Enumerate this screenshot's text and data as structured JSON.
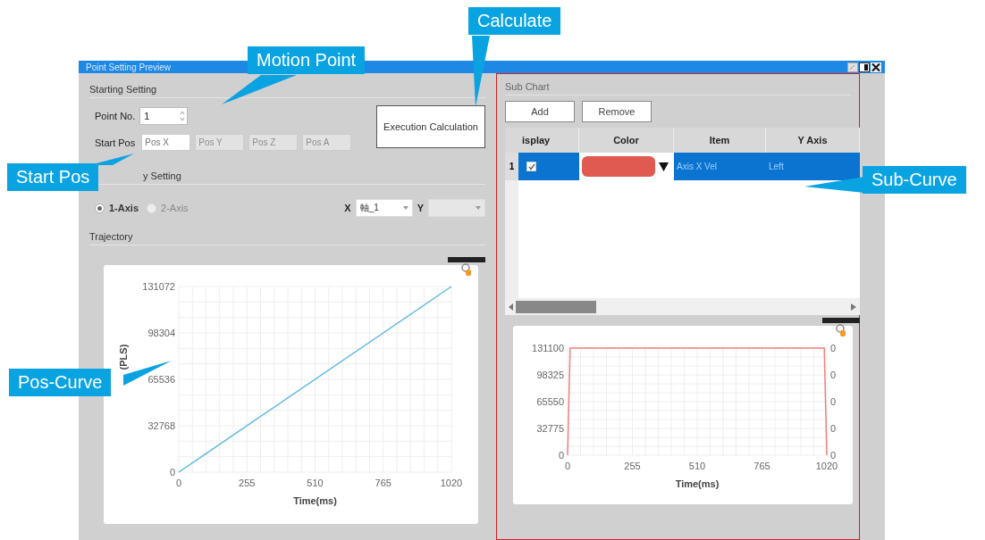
{
  "window": {
    "title": "Point Setting Preview"
  },
  "callouts": [
    {
      "text": "Calculate"
    },
    {
      "text": "Motion Point"
    },
    {
      "text": "Start Pos"
    },
    {
      "text": "Sub-Curve"
    },
    {
      "text": "Pos-Curve"
    }
  ],
  "starting_setting": {
    "title": "Starting Setting",
    "point_no": {
      "label": "Point No.",
      "value": "1"
    },
    "start_pos": {
      "label": "Start Pos",
      "fields": [
        {
          "placeholder": "Pos X",
          "disabled": false
        },
        {
          "placeholder": "Pos Y",
          "disabled": true
        },
        {
          "placeholder": "Pos Z",
          "disabled": true
        },
        {
          "placeholder": "Pos A",
          "disabled": true
        }
      ]
    },
    "execute_button": "Execution Calculation"
  },
  "display_setting": {
    "title": "y Setting",
    "axis_modes": [
      {
        "label": "1-Axis",
        "selected": true,
        "disabled": false
      },
      {
        "label": "2-Axis",
        "selected": false,
        "disabled": true
      }
    ],
    "x": {
      "label": "X",
      "value": "軸_1"
    },
    "y": {
      "label": "Y"
    }
  },
  "trajectory": {
    "title": "Trajectory",
    "chart_data": {
      "type": "line",
      "xlabel": "Time(ms)",
      "ylabel": "(PLS)",
      "x": [
        0,
        1020
      ],
      "grid": true,
      "series": [
        {
          "color": "#5bb8e0",
          "values": [
            0,
            131072
          ]
        }
      ],
      "xlim": [
        0,
        1020
      ],
      "ylim": [
        0,
        131072
      ],
      "xticks": [
        0,
        255,
        510,
        765,
        1020
      ],
      "yticks": [
        0,
        32768,
        65536,
        98304,
        131072
      ]
    }
  },
  "sub_chart": {
    "title": "Sub Chart",
    "buttons": [
      "Add",
      "Remove"
    ],
    "table": {
      "columns": [
        "isplay",
        "Color",
        "Item",
        "Y Axis"
      ],
      "rows": [
        {
          "index": "1",
          "display": true,
          "color": "#e05a52",
          "item": "Axis X Vel",
          "y_axis": "Left",
          "selected": true
        }
      ]
    },
    "chart_data": {
      "type": "line",
      "xlabel": "Time(ms)",
      "x": [
        0,
        10,
        1010,
        1020
      ],
      "grid": true,
      "series": [
        {
          "color": "#f08080",
          "values": [
            0,
            131100,
            131100,
            0
          ]
        }
      ],
      "xlim": [
        0,
        1020
      ],
      "ylim": [
        0,
        131100
      ],
      "xticks": [
        0,
        255,
        510,
        765,
        1020
      ],
      "yticks": [
        0,
        32775,
        65550,
        98325,
        131100
      ]
    },
    "right_axis_ticks": [
      "0",
      "0",
      "0",
      "0",
      "0"
    ]
  }
}
